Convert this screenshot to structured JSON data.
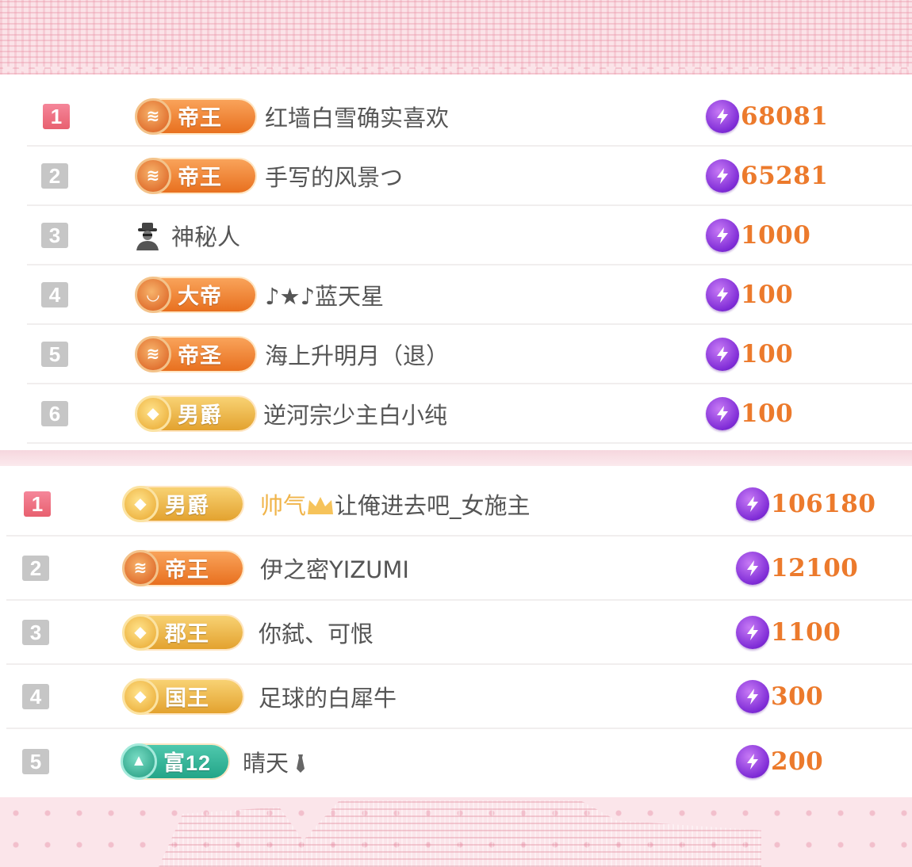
{
  "colors": {
    "score_orange": "#ec7a2c",
    "rank_first_pink": "#e8606f",
    "rank_gray": "#c6c6c6",
    "badge_orange": "#e8701f",
    "badge_gold": "#e3a22f",
    "badge_teal": "#23a588",
    "bolt_purple": "#7e2bd6"
  },
  "list1": [
    {
      "rank": "1",
      "badge": "帝王",
      "badge_style": "orange",
      "name": "红墙白雪确实喜欢",
      "score": "68081"
    },
    {
      "rank": "2",
      "badge": "帝王",
      "badge_style": "orange",
      "name": "手写的风景つ",
      "score": "65281"
    },
    {
      "rank": "3",
      "badge": "",
      "badge_style": "spy-icon",
      "name": "神秘人",
      "score": "1000"
    },
    {
      "rank": "4",
      "badge": "大帝",
      "badge_style": "orange",
      "name": "♪★♪蓝天星",
      "score": "100"
    },
    {
      "rank": "5",
      "badge": "帝圣",
      "badge_style": "orange",
      "name": "海上升明月（退）",
      "score": "100"
    },
    {
      "rank": "6",
      "badge": "男爵",
      "badge_style": "gold",
      "name": "逆河宗少主白小纯",
      "score": "100"
    }
  ],
  "list2": [
    {
      "rank": "1",
      "badge": "男爵",
      "badge_style": "gold",
      "name_prefix": "帅气",
      "name": "让俺进去吧_女施主",
      "score": "106180"
    },
    {
      "rank": "2",
      "badge": "帝王",
      "badge_style": "orange",
      "name": "伊之密YIZUMI",
      "score": "12100"
    },
    {
      "rank": "3",
      "badge": "郡王",
      "badge_style": "gold",
      "name": "你弑、可恨",
      "score": "1100"
    },
    {
      "rank": "4",
      "badge": "国王",
      "badge_style": "gold",
      "name": "足球的白犀牛",
      "score": "300"
    },
    {
      "rank": "5",
      "badge": "富12",
      "badge_style": "teal",
      "name": "晴天",
      "score": "200"
    }
  ]
}
